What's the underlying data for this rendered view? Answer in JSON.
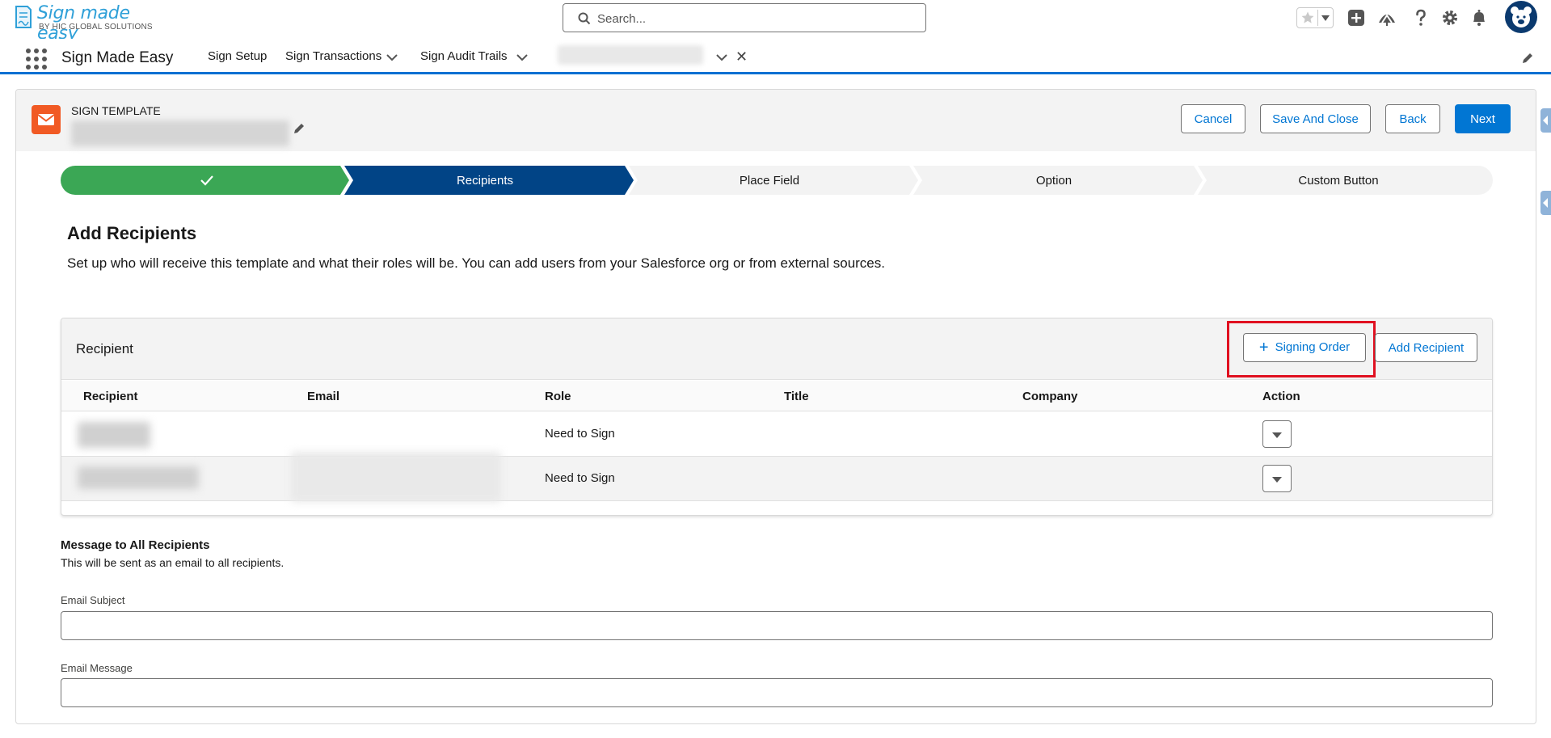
{
  "logo": {
    "title": "Sign made easy",
    "subtitle": "BY HIC GLOBAL SOLUTIONS"
  },
  "search": {
    "placeholder": "Search..."
  },
  "header_icons": [
    "favorites-star-icon",
    "add-icon",
    "trailhead-icon",
    "help-icon",
    "settings-gear-icon",
    "notifications-bell-icon",
    "user-avatar"
  ],
  "app_nav": {
    "app_name": "Sign Made Easy",
    "items": [
      {
        "label": "Sign Setup",
        "has_menu": false
      },
      {
        "label": "Sign Transactions",
        "has_menu": true
      },
      {
        "label": "Sign Audit Trails",
        "has_menu": true
      }
    ],
    "close_glyph": "✕"
  },
  "template": {
    "label": "SIGN TEMPLATE",
    "buttons": {
      "cancel": "Cancel",
      "save_close": "Save And Close",
      "back": "Back",
      "next": "Next"
    }
  },
  "path": {
    "steps": [
      {
        "label": "",
        "state": "complete"
      },
      {
        "label": "Recipients",
        "state": "current"
      },
      {
        "label": "Place Field",
        "state": "incomplete"
      },
      {
        "label": "Option",
        "state": "incomplete"
      },
      {
        "label": "Custom Button",
        "state": "incomplete"
      }
    ],
    "colors": {
      "complete": "#3ba755",
      "current": "#014486",
      "incomplete": "#f3f3f3"
    }
  },
  "section": {
    "title": "Add Recipients",
    "description": "Set up who will receive this template and what their roles will be. You can add users from your Salesforce org or from external sources."
  },
  "recipients": {
    "title": "Recipient",
    "signing_order_label": "Signing Order",
    "add_recipient_label": "Add Recipient",
    "columns": [
      "Recipient",
      "Email",
      "Role",
      "Title",
      "Company",
      "Action"
    ],
    "rows": [
      {
        "role": "Need to Sign"
      },
      {
        "role": "Need to Sign"
      }
    ]
  },
  "message": {
    "title": "Message to All Recipients",
    "subtitle": "This will be sent as an email to all recipients.",
    "subject_label": "Email Subject",
    "subject_value": "",
    "message_label": "Email Message",
    "message_value": ""
  },
  "colors": {
    "brand": "#0176d3",
    "highlight": "#e01020",
    "template_icon": "#f15a24"
  }
}
